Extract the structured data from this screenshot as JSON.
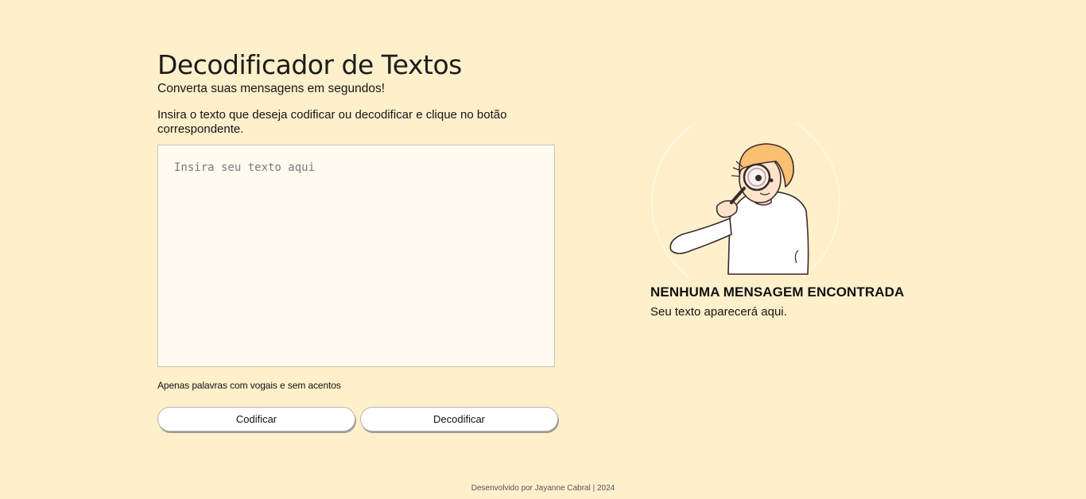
{
  "header": {
    "title": "Decodificador de Textos",
    "subtitle": "Converta suas mensagens em segundos!"
  },
  "main": {
    "instructions": "Insira o texto que deseja codificar ou decodificar e clique no botão correspondente.",
    "input": {
      "value": "",
      "placeholder": "Insira seu texto aqui"
    },
    "hint": "Apenas palavras com vogais e sem acentos",
    "encrypt_label": "Codificar",
    "decrypt_label": "Decodificar"
  },
  "output": {
    "illustration_icon": "person-with-magnifying-glass",
    "empty_title": "NENHUMA MENSAGEM ENCONTRADA",
    "empty_subtitle": "Seu texto aparecerá aqui."
  },
  "footer": {
    "text": "Desenvolvido por Jayanne Cabral | 2024"
  },
  "colors": {
    "background": "#fff0cc",
    "textarea_bg": "#fffbf0",
    "button_bg": "#ffffff"
  }
}
